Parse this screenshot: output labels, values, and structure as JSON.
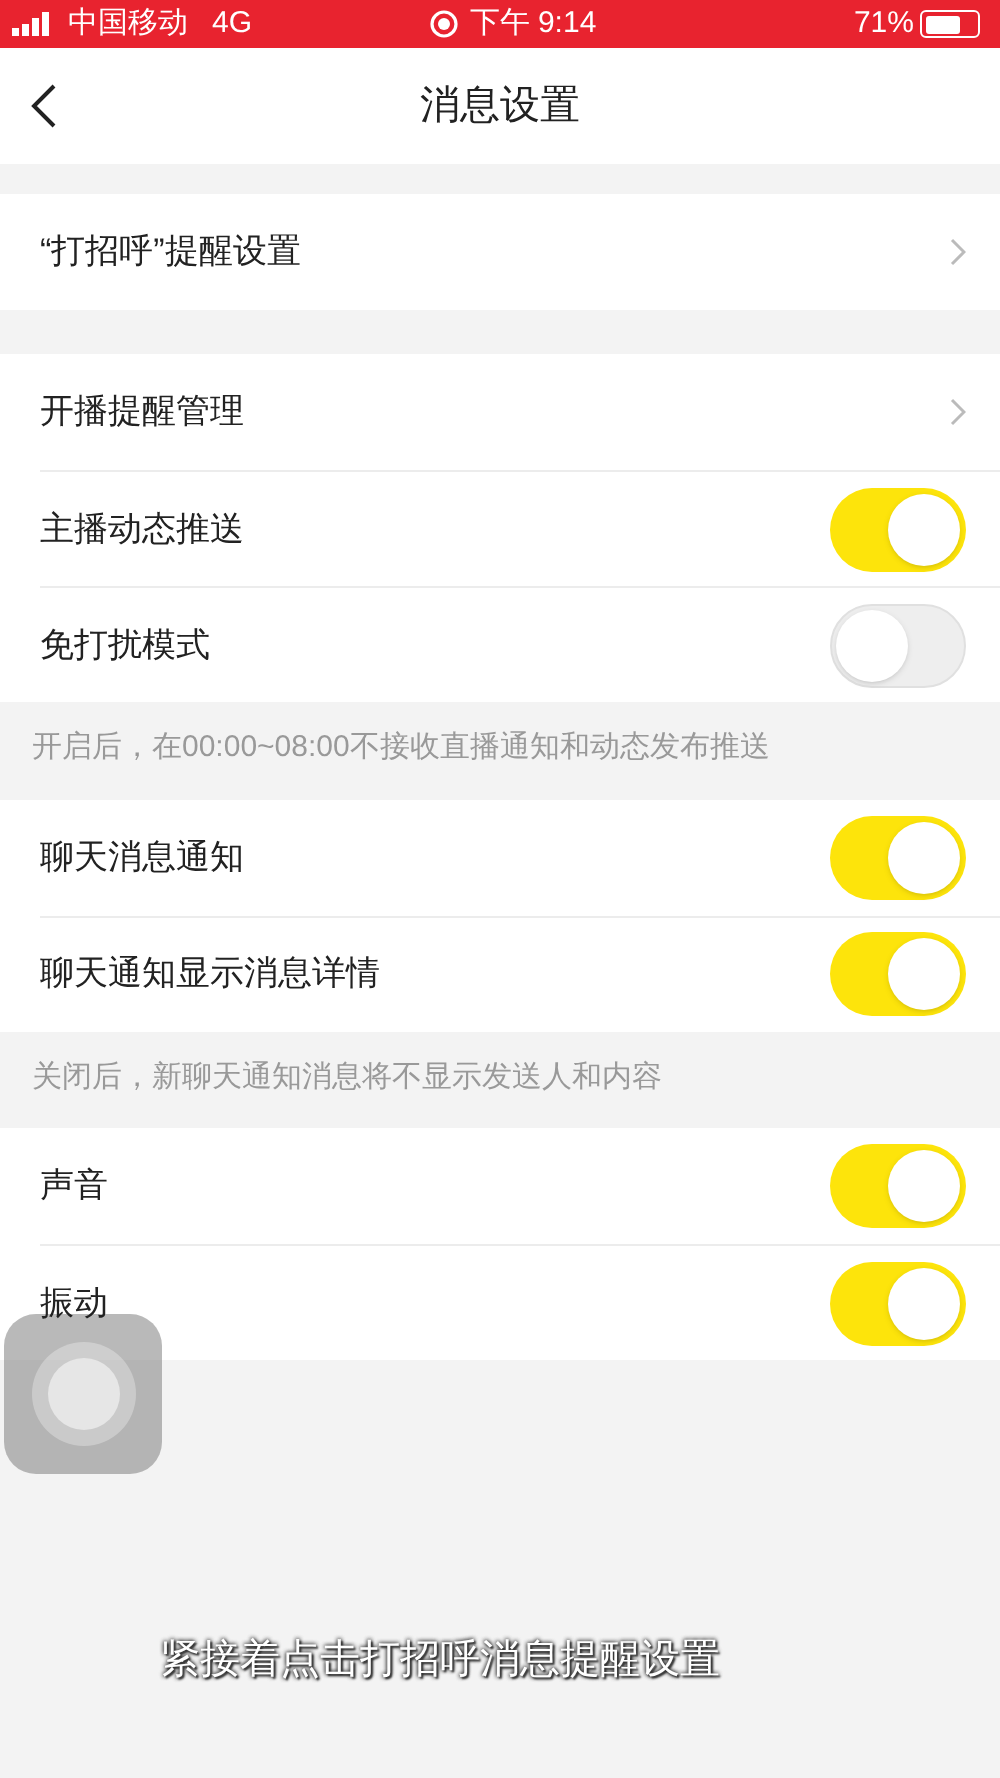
{
  "status_bar": {
    "carrier": "中国移动",
    "network": "4G",
    "time": "下午 9:14",
    "battery": "71%"
  },
  "nav": {
    "title": "消息设置"
  },
  "groups": [
    {
      "rows": [
        {
          "kind": "link",
          "label": "“打招呼”提醒设置"
        }
      ]
    },
    {
      "rows": [
        {
          "kind": "link",
          "label": "开播提醒管理"
        },
        {
          "kind": "toggle",
          "label": "主播动态推送",
          "on": true
        },
        {
          "kind": "toggle",
          "label": "免打扰模式",
          "on": false
        }
      ],
      "note": "开启后，在00:00~08:00不接收直播通知和动态发布推送"
    },
    {
      "rows": [
        {
          "kind": "toggle",
          "label": "聊天消息通知",
          "on": true
        },
        {
          "kind": "toggle",
          "label": "聊天通知显示消息详情",
          "on": true
        }
      ],
      "note": "关闭后，新聊天通知消息将不显示发送人和内容"
    },
    {
      "rows": [
        {
          "kind": "toggle",
          "label": "声音",
          "on": true
        },
        {
          "kind": "toggle",
          "label": "振动",
          "on": true
        }
      ]
    }
  ],
  "caption": "紧接着点击打招呼消息提醒设置"
}
